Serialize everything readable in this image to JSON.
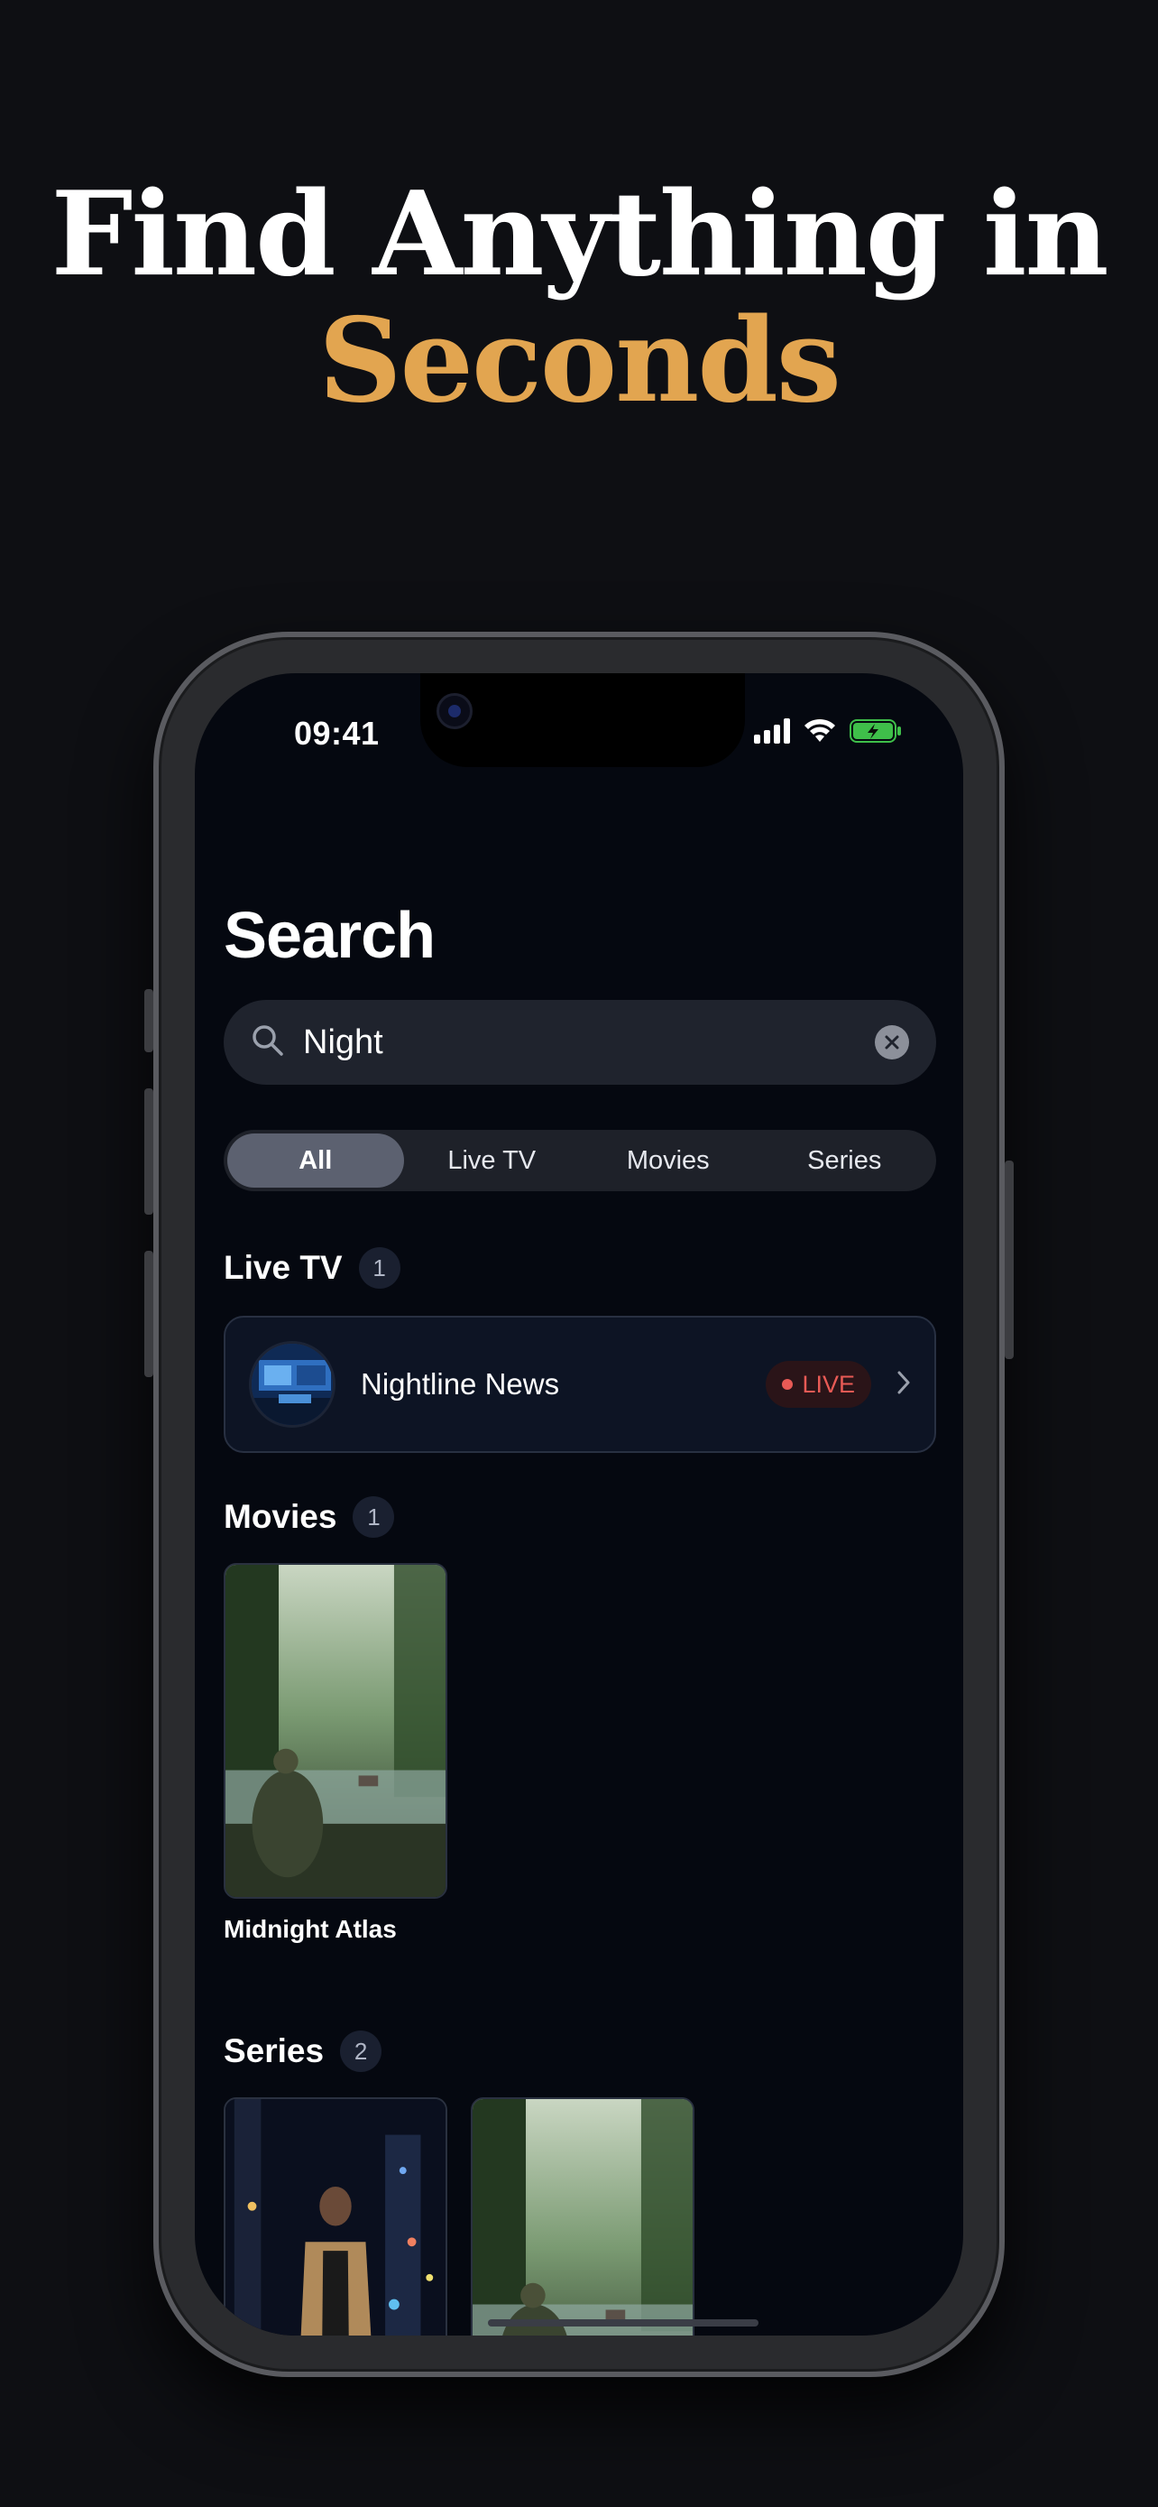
{
  "headline": {
    "line1": "Find Anything in",
    "line2": "Seconds"
  },
  "colors": {
    "accent": "#e2a550",
    "live": "#e85a55",
    "background": "#0e0f13",
    "screen": "#050810"
  },
  "status_bar": {
    "time": "09:41",
    "icons": [
      "cellular-signal-icon",
      "wifi-icon",
      "battery-charging-icon"
    ]
  },
  "page": {
    "title": "Search"
  },
  "search": {
    "value": "Night",
    "icon": "search-icon",
    "clear_icon": "clear-icon"
  },
  "segments": {
    "items": [
      "All",
      "Live TV",
      "Movies",
      "Series"
    ],
    "selected": "All"
  },
  "live_tv": {
    "title": "Live TV",
    "count": "1",
    "items": [
      {
        "name": "Nightline News",
        "badge": "LIVE"
      }
    ]
  },
  "movies": {
    "title": "Movies",
    "count": "1",
    "items": [
      {
        "title": "Midnight Atlas"
      }
    ]
  },
  "series": {
    "title": "Series",
    "count": "2"
  }
}
